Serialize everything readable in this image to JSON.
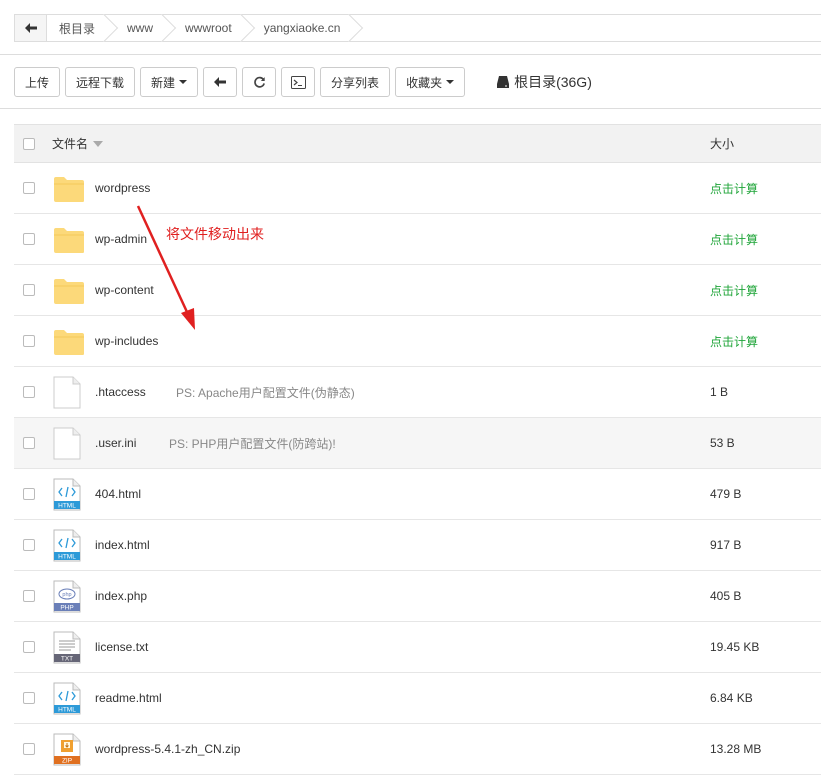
{
  "breadcrumb": {
    "items": [
      "根目录",
      "www",
      "wwwroot",
      "yangxiaoke.cn"
    ]
  },
  "toolbar": {
    "upload": "上传",
    "remote_download": "远程下载",
    "new": "新建",
    "share_list": "分享列表",
    "favorites": "收藏夹",
    "disk_label": "根目录(36G)"
  },
  "table": {
    "col_name": "文件名",
    "col_size": "大小",
    "rows": [
      {
        "name": "wordpress",
        "type": "folder",
        "size": "点击计算",
        "ps": ""
      },
      {
        "name": "wp-admin",
        "type": "folder",
        "size": "点击计算",
        "ps": ""
      },
      {
        "name": "wp-content",
        "type": "folder",
        "size": "点击计算",
        "ps": ""
      },
      {
        "name": "wp-includes",
        "type": "folder",
        "size": "点击计算",
        "ps": ""
      },
      {
        "name": ".htaccess",
        "type": "blank",
        "size": "1 B",
        "ps": "PS: Apache用户配置文件(伪静态)"
      },
      {
        "name": ".user.ini",
        "type": "blank",
        "size": "53 B",
        "ps": "PS: PHP用户配置文件(防跨站)!"
      },
      {
        "name": "404.html",
        "type": "html",
        "size": "479 B",
        "ps": ""
      },
      {
        "name": "index.html",
        "type": "html",
        "size": "917 B",
        "ps": ""
      },
      {
        "name": "index.php",
        "type": "php",
        "size": "405 B",
        "ps": ""
      },
      {
        "name": "license.txt",
        "type": "txt",
        "size": "19.45 KB",
        "ps": ""
      },
      {
        "name": "readme.html",
        "type": "html",
        "size": "6.84 KB",
        "ps": ""
      },
      {
        "name": "wordpress-5.4.1-zh_CN.zip",
        "type": "zip",
        "size": "13.28 MB",
        "ps": ""
      }
    ]
  },
  "annotation": {
    "text": "将文件移动出来",
    "color": "#e02020"
  },
  "icon_labels": {
    "html": "HTML",
    "php": "PHP",
    "txt": "TXT",
    "zip": "ZIP",
    "php_badge": "php"
  },
  "colors": {
    "calc_size": "#20a53a",
    "folder": "#fcd97a"
  }
}
